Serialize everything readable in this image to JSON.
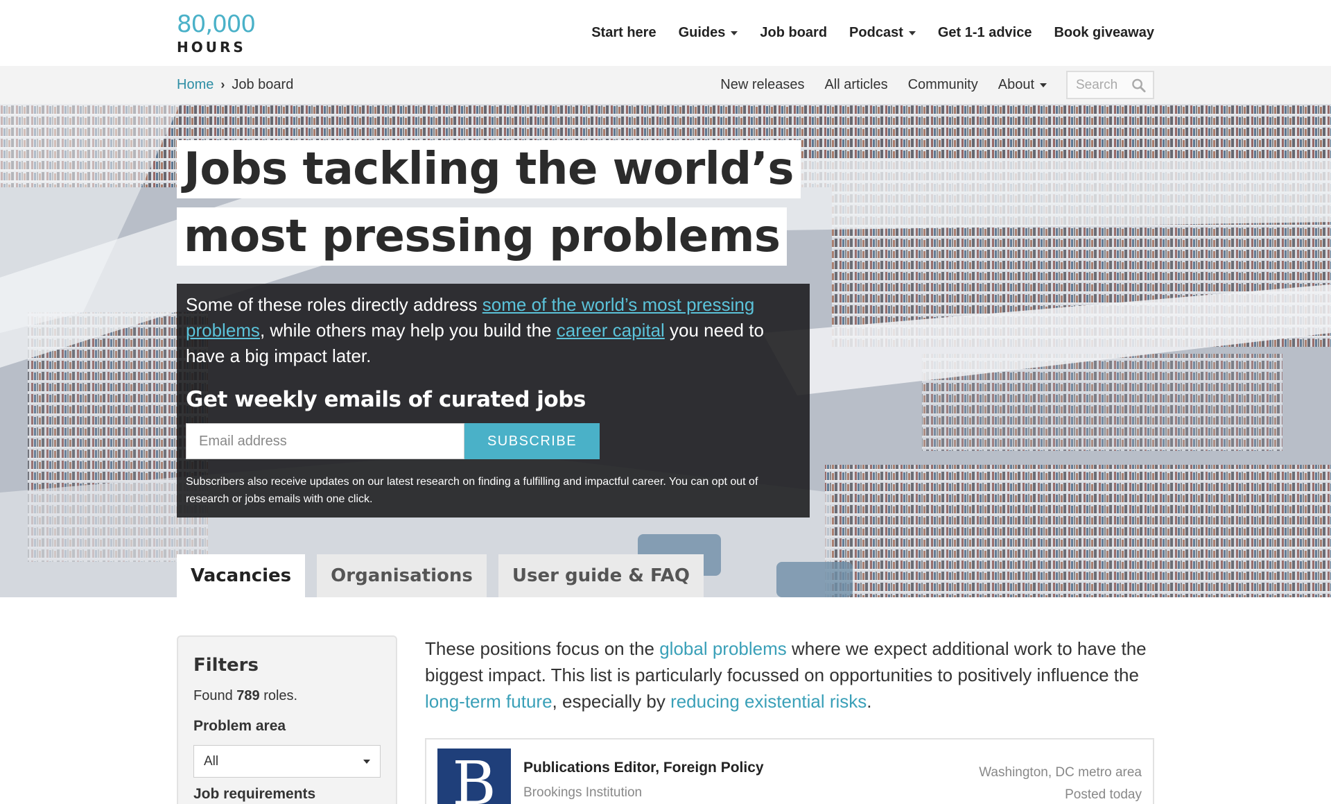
{
  "logo": {
    "number": "80,000",
    "word": "HOURS"
  },
  "main_nav": [
    {
      "label": "Start here",
      "dropdown": false
    },
    {
      "label": "Guides",
      "dropdown": true
    },
    {
      "label": "Job board",
      "dropdown": false
    },
    {
      "label": "Podcast",
      "dropdown": true
    },
    {
      "label": "Get 1-1 advice",
      "dropdown": false
    },
    {
      "label": "Book giveaway",
      "dropdown": false
    }
  ],
  "breadcrumb": {
    "home": "Home",
    "current": "Job board"
  },
  "sub_nav": [
    {
      "label": "New releases"
    },
    {
      "label": "All articles"
    },
    {
      "label": "Community"
    },
    {
      "label": "About",
      "dropdown": true
    }
  ],
  "search": {
    "placeholder": "Search"
  },
  "hero": {
    "title_line1": "Jobs tackling the world’s",
    "title_line2": "most pressing problems",
    "intro_part1": "Some of these roles directly address ",
    "intro_link1": "some of the world’s most pressing problems",
    "intro_part2": ", while others may help you build the ",
    "intro_link2": "career capital",
    "intro_part3": " you need to have a big impact later.",
    "weekly_title": "Get weekly emails of curated jobs",
    "email_placeholder": "Email address",
    "subscribe_label": "SUBSCRIBE",
    "fine_print": "Subscribers also receive updates on our latest research on finding a fulfilling and impactful career. You can opt out of research or jobs emails with one click."
  },
  "tabs": [
    {
      "label": "Vacancies",
      "active": true
    },
    {
      "label": "Organisations",
      "active": false
    },
    {
      "label": "User guide & FAQ",
      "active": false
    }
  ],
  "filters": {
    "title": "Filters",
    "found_prefix": "Found ",
    "found_count": "789",
    "found_suffix": " roles.",
    "problem_area_label": "Problem area",
    "problem_area_value": "All",
    "job_requirements_label": "Job requirements"
  },
  "lead": {
    "part1": "These positions focus on the ",
    "link1": "global problems",
    "part2": " where we expect additional work to have the biggest impact. This list is particularly focussed on opportunities to positively influence the ",
    "link2": "long-term future",
    "part3": ", especially by ",
    "link3": "reducing existential risks",
    "part4": "."
  },
  "jobs": [
    {
      "logo_letter": "B",
      "title": "Publications Editor, Foreign Policy",
      "organisation": "Brookings Institution",
      "location": "Washington, DC metro area",
      "posted": "Posted today"
    }
  ],
  "colors": {
    "accent": "#4ab1c8",
    "link": "#3aa0b8",
    "logo_blue": "#1f3f7a"
  }
}
